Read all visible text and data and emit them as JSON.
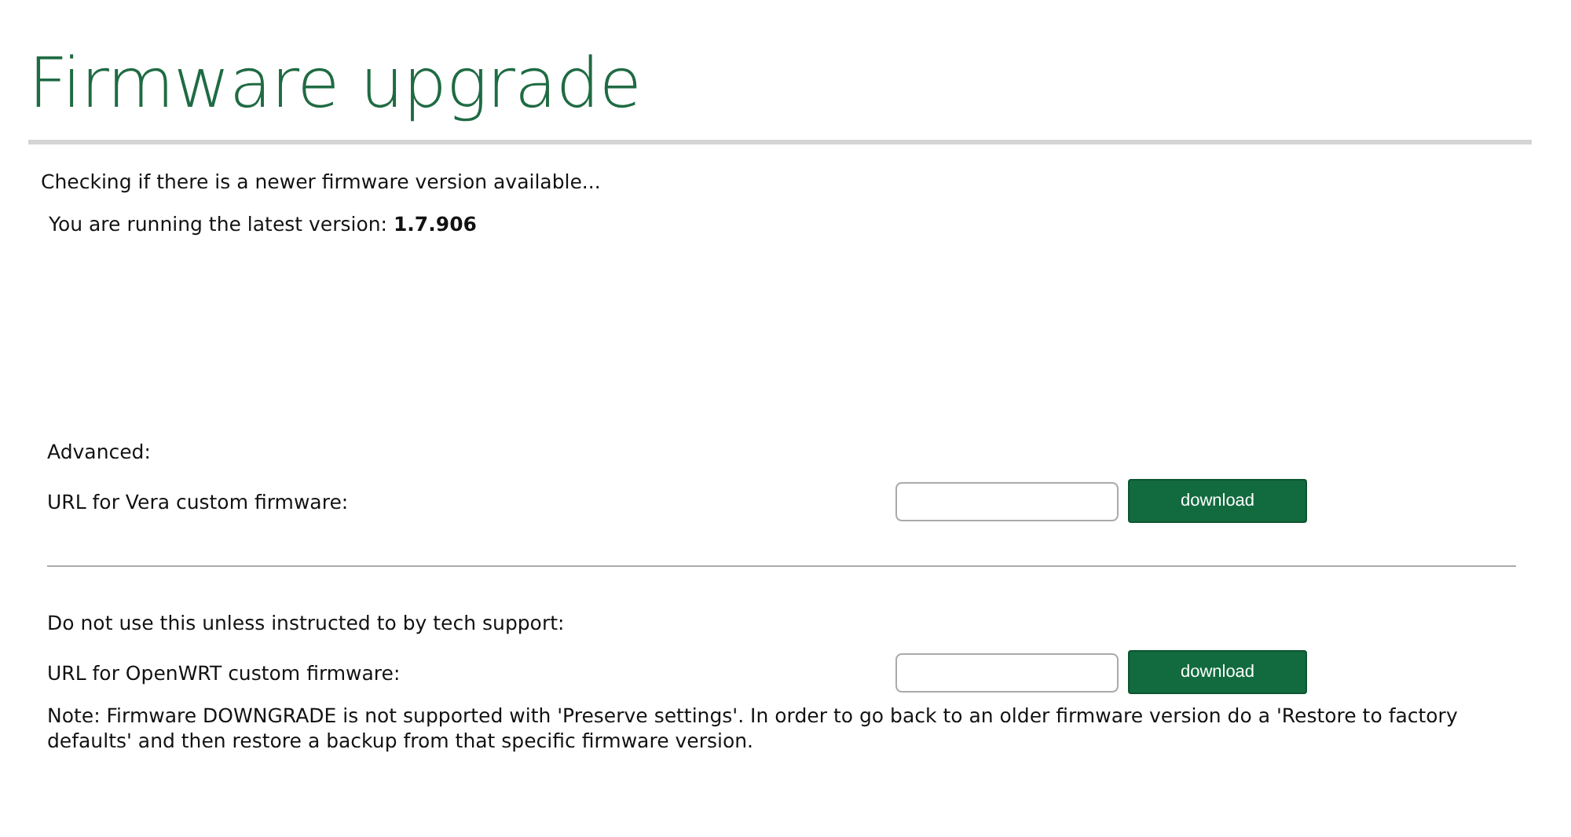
{
  "title": "Firmware upgrade",
  "status": {
    "checking": "Checking if there is a newer firmware version available...",
    "version": "You are running the latest version: **1.7.906**"
  },
  "sections": [
    {
      "heading": "Advanced:",
      "label": "URL for Vera custom firmware:",
      "button": "download"
    },
    {
      "heading": "Do not use this unless instructed to by tech support:",
      "label": "URL for OpenWRT custom firmware:",
      "button": "download",
      "note": "Note: Firmware DOWNGRADE is not supported with 'Preserve settings'. In order to go back to an older firmware version do a 'Restore to factory defaults' and then restore a backup from that specific firmware version."
    }
  ]
}
